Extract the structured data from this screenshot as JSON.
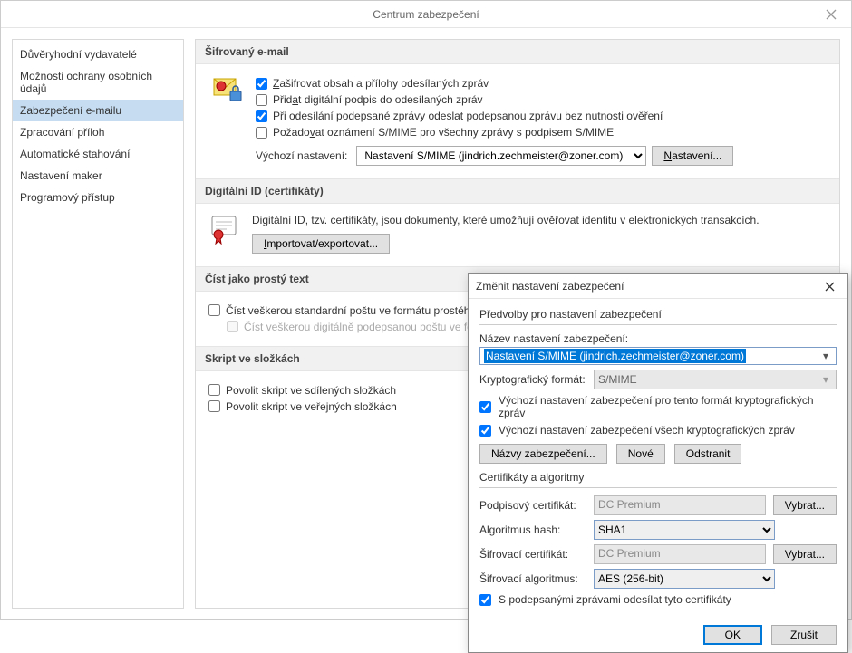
{
  "window": {
    "title": "Centrum zabezpečení"
  },
  "sidebar": {
    "items": [
      {
        "label": "Důvěryhodní vydavatelé"
      },
      {
        "label": "Možnosti ochrany osobních údajů"
      },
      {
        "label": "Zabezpečení e-mailu"
      },
      {
        "label": "Zpracování příloh"
      },
      {
        "label": "Automatické stahování"
      },
      {
        "label": "Nastavení maker"
      },
      {
        "label": "Programový přístup"
      }
    ]
  },
  "groups": {
    "encrypted": {
      "header": "Šifrovaný e-mail",
      "chk_encrypt": "Zašifrovat obsah a přílohy odesílaných zpráv",
      "chk_sign": "Přidat digitální podpis do odesílaných zpráv",
      "chk_cleartext": "Při odesílání podepsané zprávy odeslat podepsanou zprávu bez nutnosti ověření",
      "chk_receipt": "Požadovat oznámení S/MIME pro všechny zprávy s podpisem S/MIME",
      "default_label": "Výchozí nastavení:",
      "default_value": "Nastavení S/MIME (jindrich.zechmeister@zoner.com)",
      "settings_btn": "Nastavení..."
    },
    "digid": {
      "header": "Digitální ID (certifikáty)",
      "desc": "Digitální ID, tzv. certifikáty, jsou dokumenty, které umožňují ověřovat identitu v elektronických transakcích.",
      "import_btn": "Importovat/exportovat..."
    },
    "plain": {
      "header": "Číst jako prostý text",
      "chk_std": "Číst veškerou standardní poštu ve formátu prostého textu",
      "chk_signed": "Číst veškerou digitálně podepsanou poštu ve formátu prostého textu"
    },
    "script": {
      "header": "Skript ve složkách",
      "chk_shared": "Povolit skript ve sdílených složkách",
      "chk_public": "Povolit skript ve veřejných složkách"
    }
  },
  "modal": {
    "title": "Změnit nastavení zabezpečení",
    "group_prefs": "Předvolby pro nastavení zabezpečení",
    "name_label": "Název nastavení zabezpečení:",
    "name_value": "Nastavení S/MIME (jindrich.zechmeister@zoner.com)",
    "crypto_label": "Kryptografický formát:",
    "crypto_value": "S/MIME",
    "chk_default_format": "Výchozí nastavení zabezpečení pro tento formát kryptografických zpráv",
    "chk_default_all": "Výchozí nastavení zabezpečení všech kryptografických zpráv",
    "btn_labels": "Názvy zabezpečení...",
    "btn_new": "Nové",
    "btn_delete": "Odstranit",
    "group_certs": "Certifikáty a algoritmy",
    "sign_cert_label": "Podpisový certifikát:",
    "sign_cert_value": "DC Premium",
    "choose": "Vybrat...",
    "hash_label": "Algoritmus hash:",
    "hash_value": "SHA1",
    "enc_cert_label": "Šifrovací certifikát:",
    "enc_cert_value": "DC Premium",
    "enc_alg_label": "Šifrovací algoritmus:",
    "enc_alg_value": "AES (256-bit)",
    "chk_send_certs": "S podepsanými zprávami odesílat tyto certifikáty",
    "ok": "OK",
    "cancel": "Zrušit"
  }
}
